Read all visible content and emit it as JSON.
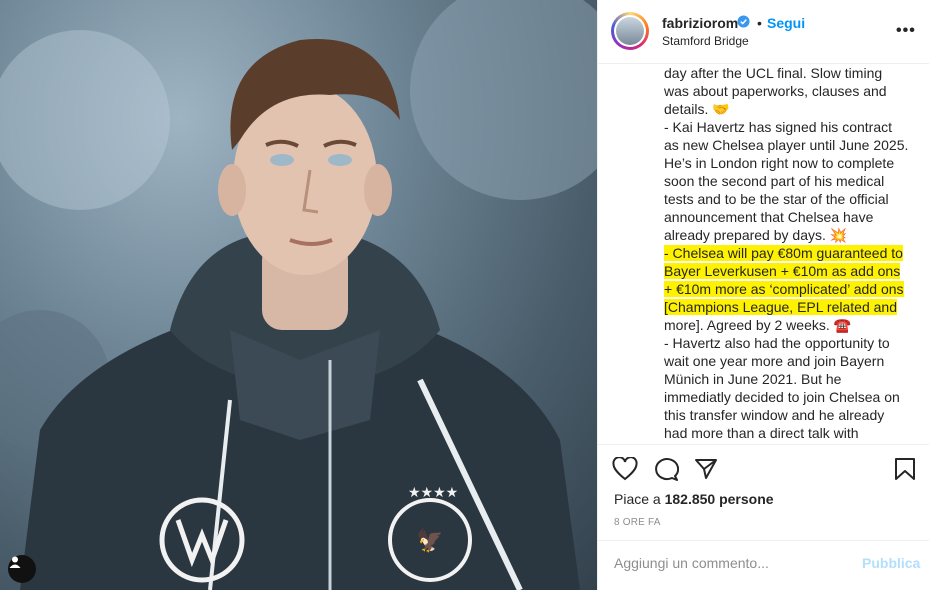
{
  "post": {
    "photo_alt": "Player photo",
    "user_tag_icon": "user-tag-icon"
  },
  "header": {
    "username": "fabriziorom",
    "verified_icon": "verified-badge-icon",
    "separator": "•",
    "follow_label": "Segui",
    "location": "Stamford Bridge",
    "more_icon": "more-options-icon"
  },
  "caption": {
    "lines": [
      {
        "text": "day after the UCL final. Slow timing",
        "highlight": false
      },
      {
        "text": "was about paperworks, clauses and",
        "highlight": false
      },
      {
        "text": "details. 🤝",
        "highlight": false
      },
      {
        "text": "- Kai Havertz has signed his contract",
        "highlight": false
      },
      {
        "text": "as new Chelsea player until June 2025.",
        "highlight": false
      },
      {
        "text": "He’s in London right now to complete",
        "highlight": false
      },
      {
        "text": "soon the second part of his medical",
        "highlight": false
      },
      {
        "text": "tests and to be the star of the official",
        "highlight": false
      },
      {
        "text": "announcement that Chelsea have",
        "highlight": false
      },
      {
        "text": "already prepared by days. 💥",
        "highlight": false
      },
      {
        "text": "- Chelsea will pay €80m guaranteed to",
        "highlight": true
      },
      {
        "text": "Bayer Leverkusen + €10m as add ons",
        "highlight": true
      },
      {
        "text": "+ €10m more as ‘complicated’ add ons",
        "highlight": true
      },
      {
        "text": "[Champions League, EPL related and",
        "highlight": true
      },
      {
        "text": "more]. Agreed by 2 weeks. ☎️",
        "highlight": false
      },
      {
        "text": "- Havertz also had the opportunity to",
        "highlight": false
      },
      {
        "text": "wait one year more and join Bayern",
        "highlight": false
      },
      {
        "text": "Münich in June 2021. But he",
        "highlight": false
      },
      {
        "text": "immediatly decided to join Chelsea on",
        "highlight": false
      },
      {
        "text": "this transfer window and he already",
        "highlight": false
      },
      {
        "text": "had more than a direct talk with",
        "highlight": false
      }
    ]
  },
  "actions": {
    "like_icon": "heart-icon",
    "comment_icon": "comment-icon",
    "share_icon": "share-icon",
    "save_icon": "bookmark-icon",
    "likes_prefix": "Piace a ",
    "likes_count": "182.850",
    "likes_suffix": " persone",
    "time_ago": "8 ORE FA"
  },
  "comment": {
    "placeholder": "Aggiungi un commento...",
    "publish_label": "Pubblica"
  },
  "colors": {
    "accent": "#0095f6",
    "highlight": "#fff200",
    "publish_disabled": "#b2dffc"
  }
}
